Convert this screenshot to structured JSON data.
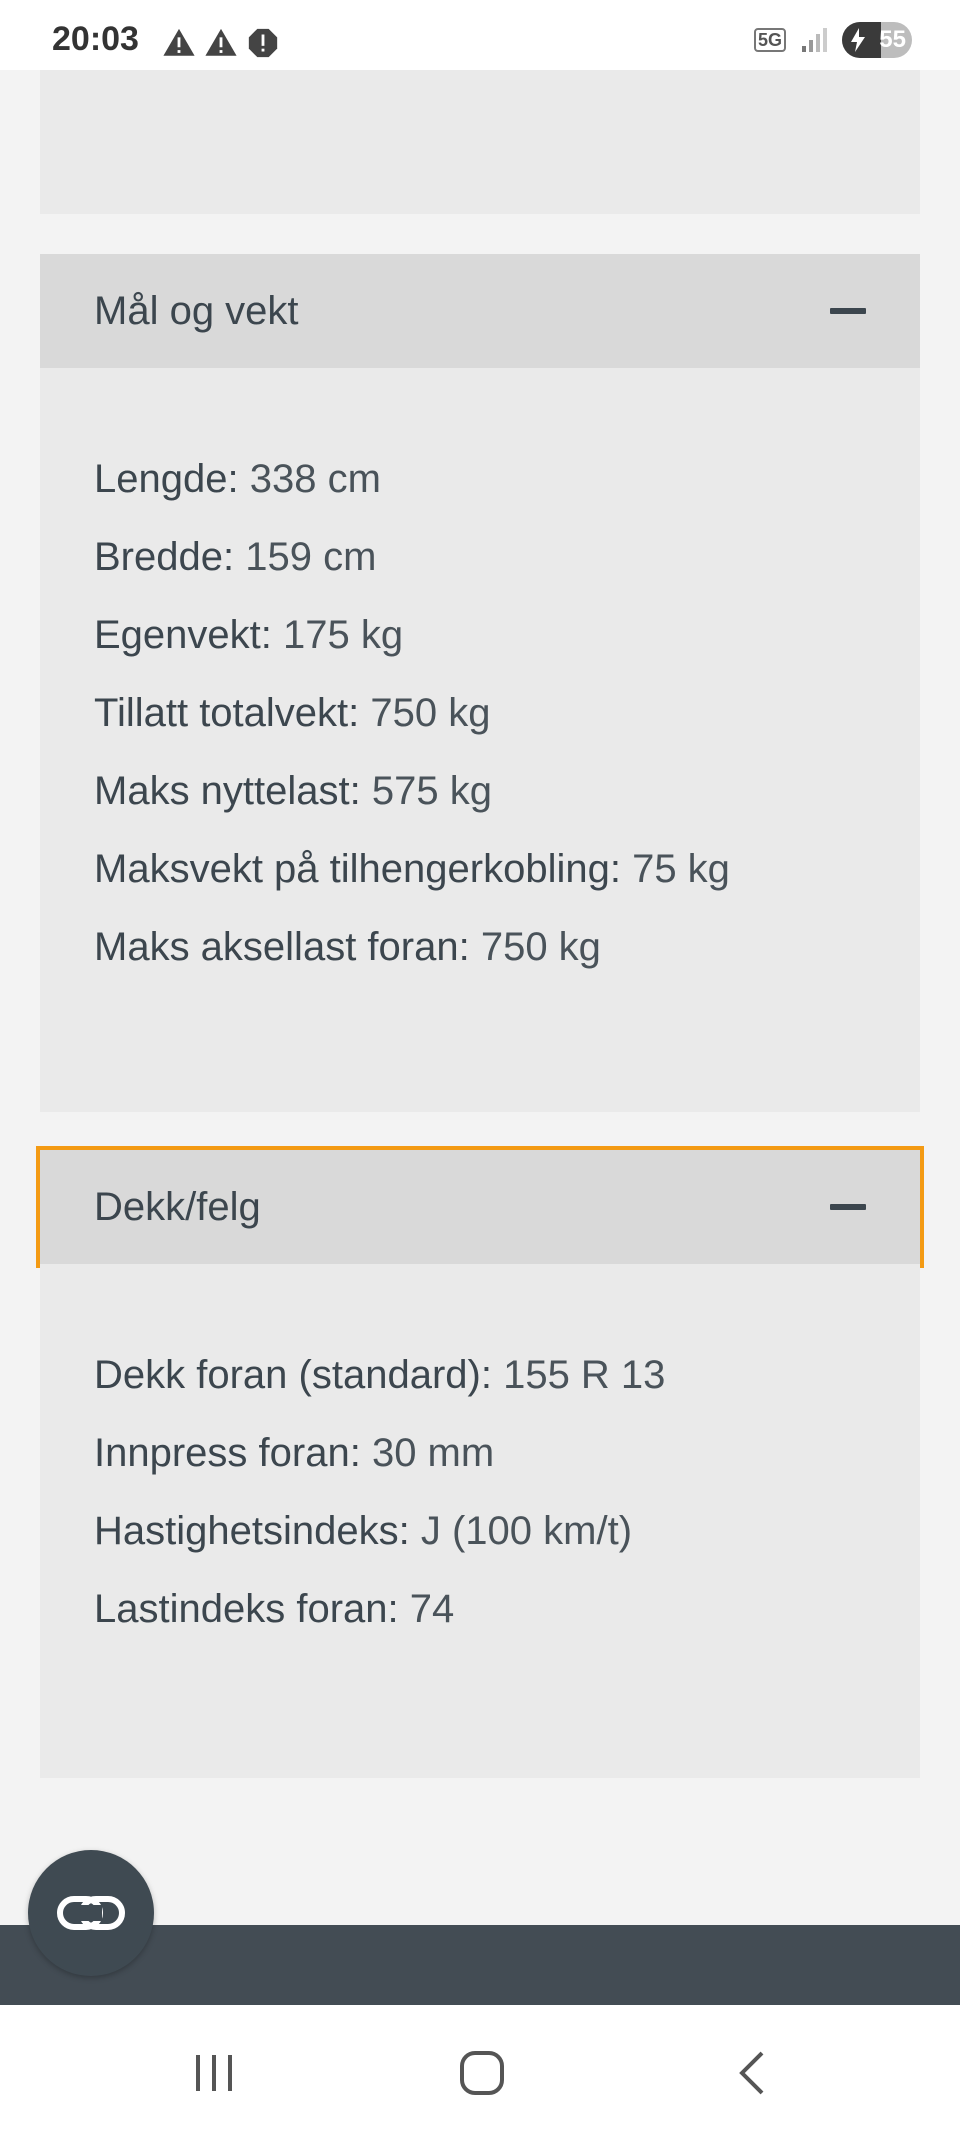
{
  "status_bar": {
    "time": "20:03",
    "network": "5G",
    "battery": "55",
    "battery_level": 0.55
  },
  "sections": [
    {
      "title": "Mål og vekt",
      "expanded": true,
      "rows": [
        {
          "key": "Lengde:",
          "value": "338 cm"
        },
        {
          "key": "Bredde:",
          "value": "159 cm"
        },
        {
          "key": "Egenvekt:",
          "value": "175 kg"
        },
        {
          "key": "Tillatt totalvekt:",
          "value": "750 kg"
        },
        {
          "key": "Maks nyttelast:",
          "value": "575 kg"
        },
        {
          "key": "Maksvekt på tilhengerkobling:",
          "value": "75 kg"
        },
        {
          "key": "Maks aksellast foran:",
          "value": "750 kg"
        }
      ]
    },
    {
      "title": "Dekk/felg",
      "expanded": true,
      "focused": true,
      "rows": [
        {
          "key": "Dekk foran (standard):",
          "value": "155 R 13"
        },
        {
          "key": "Innpress foran:",
          "value": "30 mm"
        },
        {
          "key": "Hastighetsindeks:",
          "value": "J (100 km/t)"
        },
        {
          "key": "Lastindeks foran:",
          "value": "74"
        }
      ]
    }
  ],
  "icons": {
    "fab": "chat-link-icon",
    "nav_recent": "recent-apps-icon",
    "nav_home": "home-icon",
    "nav_back": "back-icon"
  },
  "colors": {
    "focus_outline": "#f39a13",
    "header_bg": "#d9d9d9",
    "panel_bg": "#eaeaea",
    "text": "#3c464e",
    "footer": "#434c54"
  }
}
